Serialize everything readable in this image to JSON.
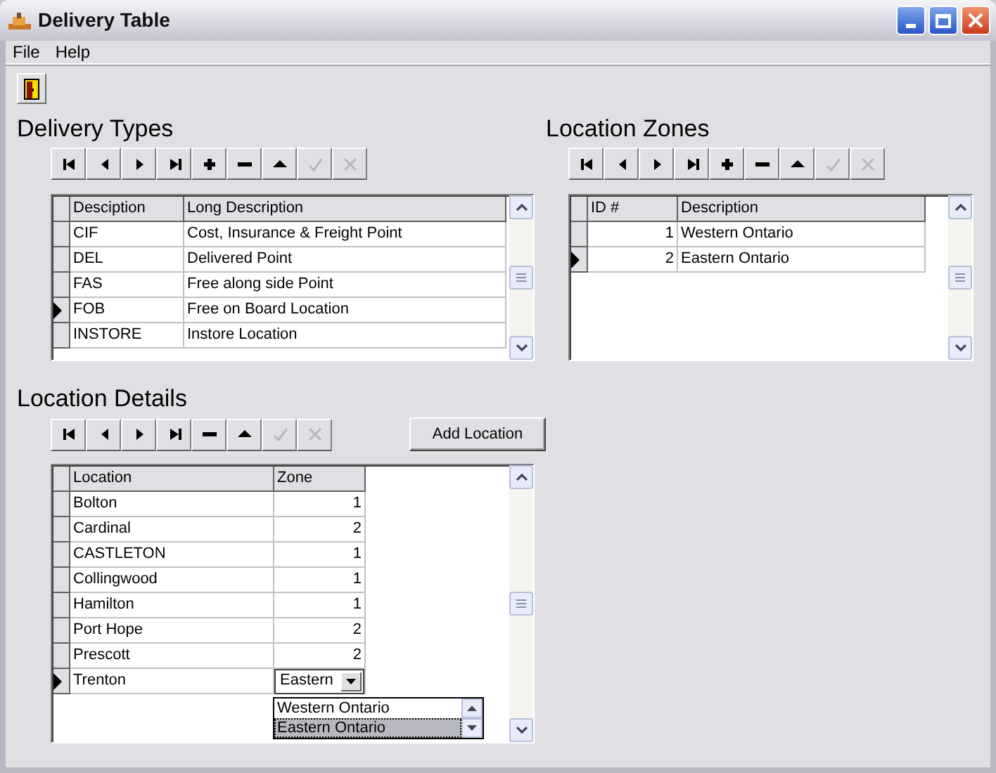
{
  "window": {
    "title": "Delivery Table"
  },
  "menu": [
    {
      "label": "File"
    },
    {
      "label": "Help"
    }
  ],
  "delivery_types": {
    "title": "Delivery Types",
    "navigator": [
      {
        "kind": "first",
        "disabled": false
      },
      {
        "kind": "prior",
        "disabled": false
      },
      {
        "kind": "next",
        "disabled": false
      },
      {
        "kind": "last",
        "disabled": false
      },
      {
        "kind": "insert",
        "disabled": false
      },
      {
        "kind": "delete",
        "disabled": false
      },
      {
        "kind": "edit",
        "disabled": false
      },
      {
        "kind": "post",
        "disabled": true
      },
      {
        "kind": "cancel",
        "disabled": true
      }
    ],
    "columns": [
      "Desciption",
      "Long Description"
    ],
    "rows": [
      {
        "cells": [
          "CIF",
          "Cost, Insurance & Freight Point"
        ],
        "selected": false
      },
      {
        "cells": [
          "DEL",
          "Delivered Point"
        ],
        "selected": false
      },
      {
        "cells": [
          "FAS",
          "Free along side Point"
        ],
        "selected": false
      },
      {
        "cells": [
          "FOB",
          "Free on Board Location"
        ],
        "selected": true
      },
      {
        "cells": [
          "INSTORE",
          "Instore Location"
        ],
        "selected": false
      }
    ]
  },
  "location_zones": {
    "title": "Location Zones",
    "navigator": [
      {
        "kind": "first",
        "disabled": false
      },
      {
        "kind": "prior",
        "disabled": false
      },
      {
        "kind": "next",
        "disabled": false
      },
      {
        "kind": "last",
        "disabled": false
      },
      {
        "kind": "insert",
        "disabled": false
      },
      {
        "kind": "delete",
        "disabled": false
      },
      {
        "kind": "edit",
        "disabled": false
      },
      {
        "kind": "post",
        "disabled": true
      },
      {
        "kind": "cancel",
        "disabled": true
      }
    ],
    "columns": [
      "ID #",
      "Description"
    ],
    "rows": [
      {
        "cells": [
          "1",
          "Western Ontario"
        ],
        "selected": false
      },
      {
        "cells": [
          "2",
          "Eastern Ontario"
        ],
        "selected": true
      }
    ]
  },
  "location_details": {
    "title": "Location Details",
    "navigator": [
      {
        "kind": "first",
        "disabled": false
      },
      {
        "kind": "prior",
        "disabled": false
      },
      {
        "kind": "next",
        "disabled": false
      },
      {
        "kind": "last",
        "disabled": false
      },
      {
        "kind": "delete",
        "disabled": false
      },
      {
        "kind": "edit",
        "disabled": false
      },
      {
        "kind": "post",
        "disabled": true
      },
      {
        "kind": "cancel",
        "disabled": true
      }
    ],
    "add_button": "Add Location",
    "columns": [
      "Location",
      "Zone"
    ],
    "rows": [
      {
        "cells": [
          "Bolton",
          "1"
        ],
        "selected": false
      },
      {
        "cells": [
          "Cardinal",
          "2"
        ],
        "selected": false
      },
      {
        "cells": [
          "CASTLETON",
          "1"
        ],
        "selected": false
      },
      {
        "cells": [
          "Collingwood",
          "1"
        ],
        "selected": false
      },
      {
        "cells": [
          "Hamilton",
          "1"
        ],
        "selected": false
      },
      {
        "cells": [
          "Port Hope",
          "2"
        ],
        "selected": false
      },
      {
        "cells": [
          "Prescott",
          "2"
        ],
        "selected": false
      },
      {
        "cells": [
          "Trenton"
        ],
        "editor": "Eastern",
        "selected": true
      }
    ],
    "dropdown": [
      {
        "label": "Western Ontario",
        "selected": false
      },
      {
        "label": "Eastern Ontario",
        "selected": true
      }
    ]
  }
}
